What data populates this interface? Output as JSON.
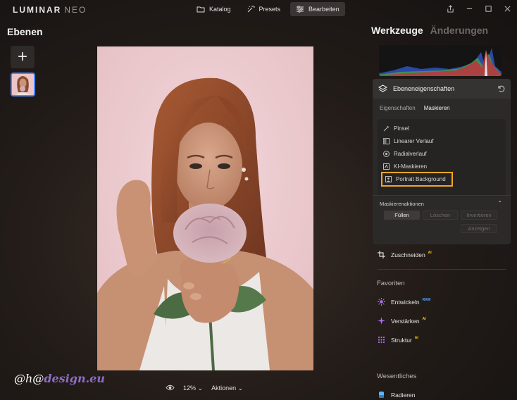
{
  "app": {
    "logo": "LUMINAR",
    "logo_suffix": "NEO"
  },
  "nav": {
    "tabs": [
      {
        "label": "Katalog"
      },
      {
        "label": "Presets"
      },
      {
        "label": "Bearbeiten"
      }
    ],
    "active": "Bearbeiten"
  },
  "left_panel": {
    "title": "Ebenen",
    "add_label": "+"
  },
  "canvas": {
    "zoom": "12%",
    "actions_label": "Aktionen"
  },
  "watermark": {
    "prefix": "@h@",
    "site": "design.eu"
  },
  "right_panel": {
    "tabs": [
      {
        "label": "Werkzeuge"
      },
      {
        "label": "Änderungen"
      }
    ],
    "layer_props": {
      "title": "Ebeneneigenschaften",
      "subtabs": [
        {
          "label": "Eigenschaften"
        },
        {
          "label": "Maskieren"
        }
      ],
      "active_subtab": "Maskieren",
      "mask_items": [
        {
          "label": "Pinsel",
          "icon": "brush-icon"
        },
        {
          "label": "Linearer Verlauf",
          "icon": "linear-gradient-icon"
        },
        {
          "label": "Radialverlauf",
          "icon": "radial-gradient-icon"
        },
        {
          "label": "KI-Maskieren",
          "icon": "ai-mask-icon"
        },
        {
          "label": "Portrait Background",
          "icon": "portrait-icon",
          "highlighted": true
        }
      ],
      "mask_actions": {
        "title": "Maskierenaktionen",
        "buttons": [
          {
            "label": "Füllen",
            "enabled": true
          },
          {
            "label": "Löschen",
            "enabled": false
          },
          {
            "label": "Invertieren",
            "enabled": false
          },
          {
            "label": "Anzeigen",
            "enabled": false
          }
        ]
      }
    },
    "crop": {
      "label": "Zuschneiden",
      "badge": "AI"
    },
    "favorites": {
      "title": "Favoriten",
      "items": [
        {
          "label": "Entwickeln",
          "badge": "RAW"
        },
        {
          "label": "Verstärken",
          "badge": "AI"
        },
        {
          "label": "Struktur",
          "badge": "AI"
        }
      ]
    },
    "essentials": {
      "title": "Wesentliches",
      "items": [
        {
          "label": "Radieren"
        }
      ]
    }
  },
  "colors": {
    "highlight": "#f0a528",
    "accent_blue": "#4d88ff",
    "badge_yellow": "#f5c518",
    "badge_blue": "#5aa0ff",
    "icon_purple": "#b06cff"
  }
}
